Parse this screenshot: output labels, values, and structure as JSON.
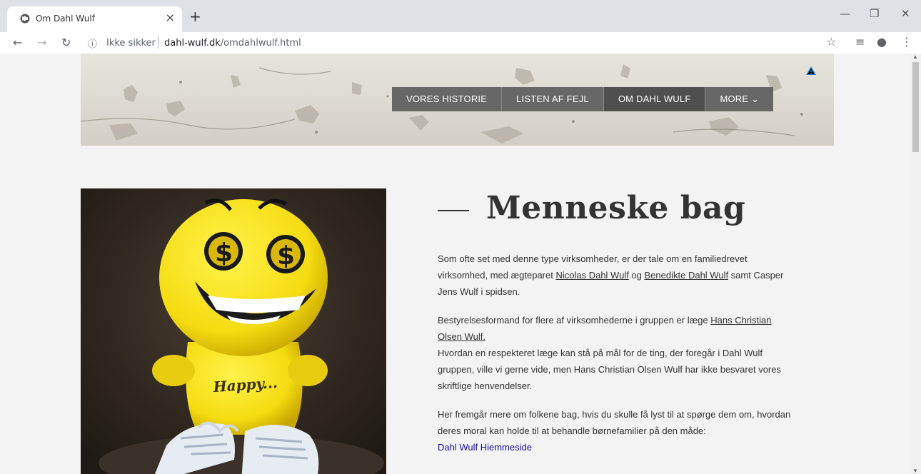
{
  "browser": {
    "tab_title": "Om Dahl Wulf",
    "tab_close": "×",
    "new_tab": "+",
    "security_label": "Ikke sikker",
    "url_host": "dahl-wulf.dk",
    "url_path": "/omdahlwulf.html",
    "window_controls": {
      "minimize": "—",
      "restore": "❐",
      "close": "✕"
    }
  },
  "nav": {
    "items": [
      {
        "label": "VORES HISTORIE"
      },
      {
        "label": "LISTEN AF FEJL"
      },
      {
        "label": "OM DAHL WULF",
        "active": true
      },
      {
        "label": "MORE ⌄"
      }
    ]
  },
  "main": {
    "heading": "Menneske bag",
    "para1_a": "Som ofte set med denne type virksomheder, er der tale om en familiedrevet virksomhed, med ægteparet ",
    "para1_link1": "Nicolas Dahl Wulf",
    "para1_b": " og ",
    "para1_link2": "Benedikte Dahl Wulf",
    "para1_c": " samt Casper Jens Wulf i spidsen.",
    "para2_a": "Bestyrelsesformand for flere af virksomhederne i gruppen er læge ",
    "para2_link": "Hans Christian Olsen Wulf.",
    "para2_b": "Hvordan en respekteret læge kan stå på mål for de ting, der foregår i Dahl Wulf gruppen, ville vi gerne vide, men Hans Christian Olsen Wulf har ikke besvaret vores skriftlige henvendelser.",
    "para3": "Her fremgår mere om folkene bag, hvis du skulle få lyst til at spørge dem om, hvordan deres moral kan holde til at behandle børnefamilier på den måde:",
    "link_homepage": "Dahl Wulf Hiemmeside",
    "photo_text": "Happy..."
  },
  "colors": {
    "menu_bg": "#676767",
    "menu_active": "#4f4f4f",
    "page_bg": "#f3f3f3",
    "link_blue": "#1a0dab",
    "smiley_yellow": "#f5dc12"
  }
}
